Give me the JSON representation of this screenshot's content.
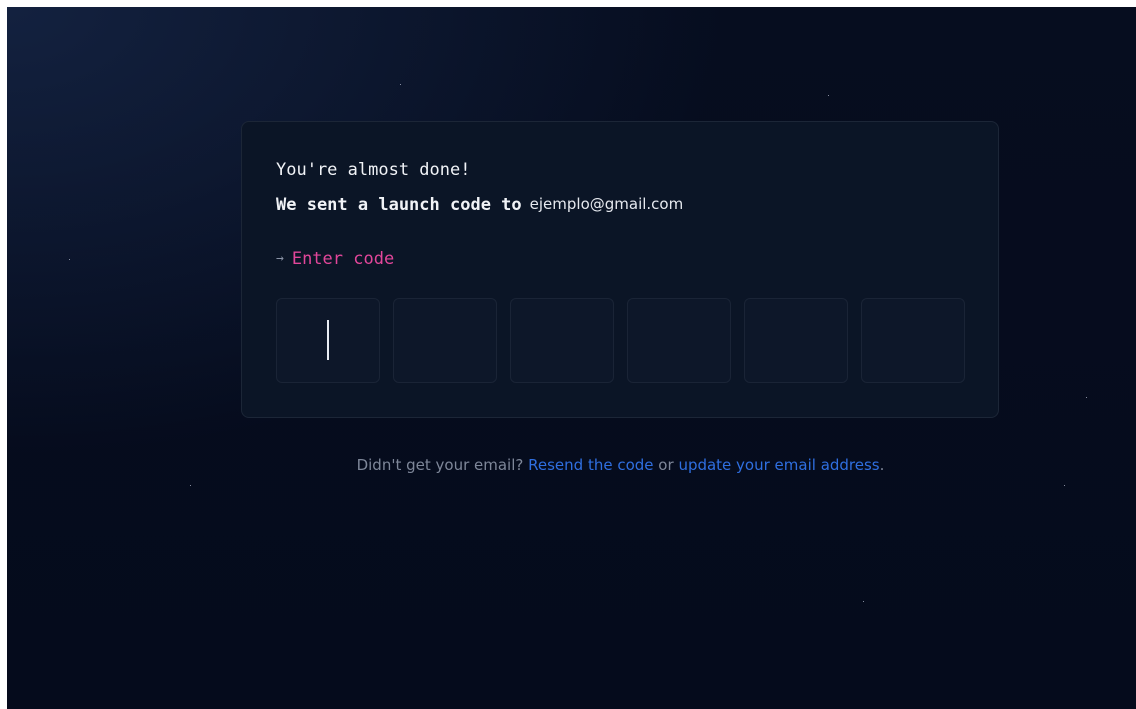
{
  "card": {
    "heading": "You're almost done!",
    "sent_text": "We sent a launch code to",
    "email": "ejemplo@gmail.com",
    "prompt_arrow": "→",
    "prompt_label": "Enter code",
    "code_digits": [
      "",
      "",
      "",
      "",
      "",
      ""
    ]
  },
  "footer": {
    "question": "Didn't get your email?",
    "resend_link": "Resend the code",
    "or": "or",
    "update_link": "update your email address",
    "period": "."
  },
  "colors": {
    "background": "#060d1f",
    "card": "#0b1526",
    "accent_pink": "#e2469a",
    "link_blue": "#2f6fe0",
    "muted_text": "#7e8799"
  }
}
